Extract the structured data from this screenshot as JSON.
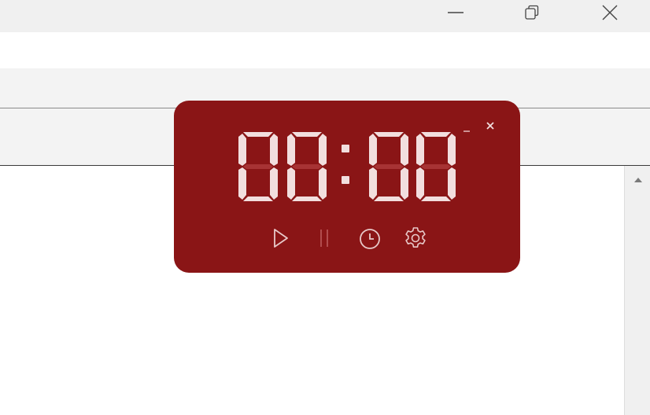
{
  "window": {
    "controls": [
      "minimize",
      "restore",
      "close"
    ]
  },
  "timer": {
    "display": [
      "0",
      "0",
      "0",
      "0"
    ],
    "colon": ":",
    "colors": {
      "background": "#8a1516",
      "segment_on": "#f2dede",
      "segment_off": "#a73334",
      "icon": "#e8c9c9",
      "icon_disabled": "#b24c4d"
    },
    "controls": [
      "play-icon",
      "pause-icon",
      "clock-icon",
      "gear-icon"
    ],
    "header_buttons": [
      "minimize-icon",
      "close-icon"
    ]
  }
}
